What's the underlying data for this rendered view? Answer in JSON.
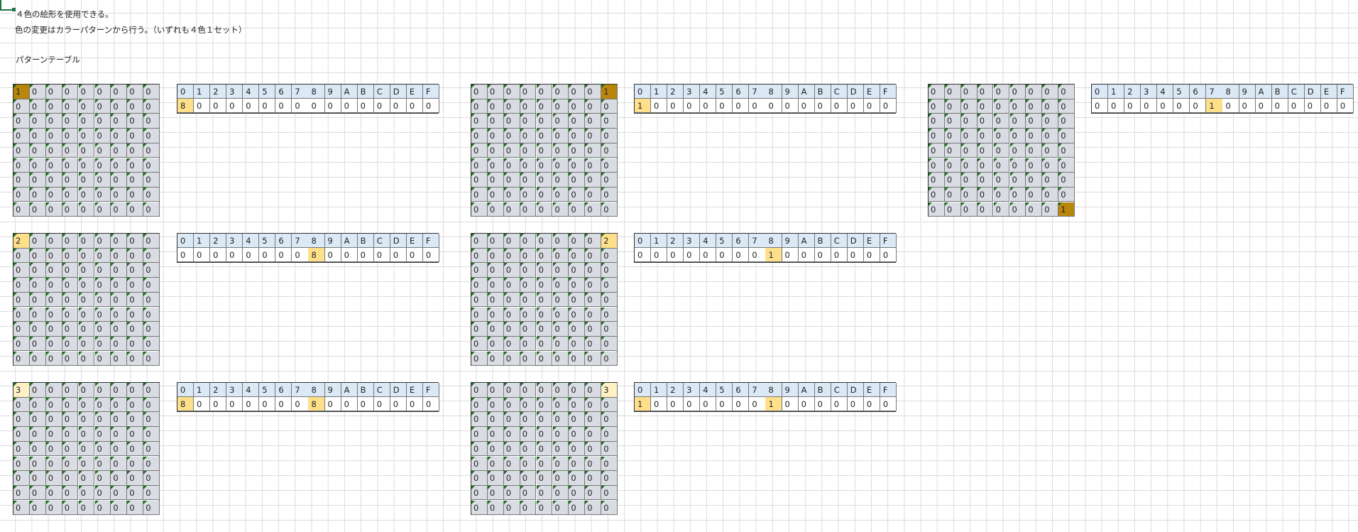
{
  "notes": {
    "line1": "４色の絵形を使用できる。",
    "line2": "色の変更はカラーパターンから行う。（いずれも４色１セット）",
    "line3": "パターンテーブル"
  },
  "colors": {
    "grid_fill": "#d9dde3",
    "dark_highlight": "#b8860b",
    "light_highlight": "#ffe08a",
    "pale_highlight": "#fff1c4",
    "header_fill": "#dbe8f5",
    "corner_mark": "#1b6b1b"
  },
  "pattern_headers": [
    "0",
    "1",
    "2",
    "3",
    "4",
    "5",
    "6",
    "7",
    "8",
    "9",
    "A",
    "B",
    "C",
    "D",
    "E",
    "F"
  ],
  "blocks": [
    {
      "grid": [
        [
          "1",
          "0",
          "0",
          "0",
          "0",
          "0",
          "0",
          "0",
          "0"
        ],
        [
          "0",
          "0",
          "0",
          "0",
          "0",
          "0",
          "0",
          "0",
          "0"
        ],
        [
          "0",
          "0",
          "0",
          "0",
          "0",
          "0",
          "0",
          "0",
          "0"
        ],
        [
          "0",
          "0",
          "0",
          "0",
          "0",
          "0",
          "0",
          "0",
          "0"
        ],
        [
          "0",
          "0",
          "0",
          "0",
          "0",
          "0",
          "0",
          "0",
          "0"
        ],
        [
          "0",
          "0",
          "0",
          "0",
          "0",
          "0",
          "0",
          "0",
          "0"
        ],
        [
          "0",
          "0",
          "0",
          "0",
          "0",
          "0",
          "0",
          "0",
          "0"
        ],
        [
          "0",
          "0",
          "0",
          "0",
          "0",
          "0",
          "0",
          "0",
          "0"
        ],
        [
          "0",
          "0",
          "0",
          "0",
          "0",
          "0",
          "0",
          "0",
          "0"
        ]
      ],
      "highlights": [
        {
          "r": 0,
          "c": 0,
          "style": "hl-dark"
        }
      ],
      "pattern": [
        "8",
        "0",
        "0",
        "0",
        "0",
        "0",
        "0",
        "0",
        "0",
        "0",
        "0",
        "0",
        "0",
        "0",
        "0",
        "0"
      ],
      "pattern_highlights": [
        0
      ]
    },
    {
      "grid": [
        [
          "0",
          "0",
          "0",
          "0",
          "0",
          "0",
          "0",
          "0",
          "1"
        ],
        [
          "0",
          "0",
          "0",
          "0",
          "0",
          "0",
          "0",
          "0",
          "0"
        ],
        [
          "0",
          "0",
          "0",
          "0",
          "0",
          "0",
          "0",
          "0",
          "0"
        ],
        [
          "0",
          "0",
          "0",
          "0",
          "0",
          "0",
          "0",
          "0",
          "0"
        ],
        [
          "0",
          "0",
          "0",
          "0",
          "0",
          "0",
          "0",
          "0",
          "0"
        ],
        [
          "0",
          "0",
          "0",
          "0",
          "0",
          "0",
          "0",
          "0",
          "0"
        ],
        [
          "0",
          "0",
          "0",
          "0",
          "0",
          "0",
          "0",
          "0",
          "0"
        ],
        [
          "0",
          "0",
          "0",
          "0",
          "0",
          "0",
          "0",
          "0",
          "0"
        ],
        [
          "0",
          "0",
          "0",
          "0",
          "0",
          "0",
          "0",
          "0",
          "0"
        ]
      ],
      "highlights": [
        {
          "r": 0,
          "c": 8,
          "style": "hl-dark"
        }
      ],
      "pattern": [
        "1",
        "0",
        "0",
        "0",
        "0",
        "0",
        "0",
        "0",
        "0",
        "0",
        "0",
        "0",
        "0",
        "0",
        "0",
        "0"
      ],
      "pattern_highlights": [
        0
      ]
    },
    {
      "grid": [
        [
          "0",
          "0",
          "0",
          "0",
          "0",
          "0",
          "0",
          "0",
          "0"
        ],
        [
          "0",
          "0",
          "0",
          "0",
          "0",
          "0",
          "0",
          "0",
          "0"
        ],
        [
          "0",
          "0",
          "0",
          "0",
          "0",
          "0",
          "0",
          "0",
          "0"
        ],
        [
          "0",
          "0",
          "0",
          "0",
          "0",
          "0",
          "0",
          "0",
          "0"
        ],
        [
          "0",
          "0",
          "0",
          "0",
          "0",
          "0",
          "0",
          "0",
          "0"
        ],
        [
          "0",
          "0",
          "0",
          "0",
          "0",
          "0",
          "0",
          "0",
          "0"
        ],
        [
          "0",
          "0",
          "0",
          "0",
          "0",
          "0",
          "0",
          "0",
          "0"
        ],
        [
          "0",
          "0",
          "0",
          "0",
          "0",
          "0",
          "0",
          "0",
          "0"
        ],
        [
          "0",
          "0",
          "0",
          "0",
          "0",
          "0",
          "0",
          "0",
          "1"
        ]
      ],
      "highlights": [
        {
          "r": 8,
          "c": 8,
          "style": "hl-dark"
        }
      ],
      "pattern": [
        "0",
        "0",
        "0",
        "0",
        "0",
        "0",
        "0",
        "1",
        "0",
        "0",
        "0",
        "0",
        "0",
        "0",
        "0",
        "0"
      ],
      "pattern_highlights": [
        7
      ]
    },
    {
      "grid": [
        [
          "2",
          "0",
          "0",
          "0",
          "0",
          "0",
          "0",
          "0",
          "0"
        ],
        [
          "0",
          "0",
          "0",
          "0",
          "0",
          "0",
          "0",
          "0",
          "0"
        ],
        [
          "0",
          "0",
          "0",
          "0",
          "0",
          "0",
          "0",
          "0",
          "0"
        ],
        [
          "0",
          "0",
          "0",
          "0",
          "0",
          "0",
          "0",
          "0",
          "0"
        ],
        [
          "0",
          "0",
          "0",
          "0",
          "0",
          "0",
          "0",
          "0",
          "0"
        ],
        [
          "0",
          "0",
          "0",
          "0",
          "0",
          "0",
          "0",
          "0",
          "0"
        ],
        [
          "0",
          "0",
          "0",
          "0",
          "0",
          "0",
          "0",
          "0",
          "0"
        ],
        [
          "0",
          "0",
          "0",
          "0",
          "0",
          "0",
          "0",
          "0",
          "0"
        ],
        [
          "0",
          "0",
          "0",
          "0",
          "0",
          "0",
          "0",
          "0",
          "0"
        ]
      ],
      "highlights": [
        {
          "r": 0,
          "c": 0,
          "style": "hl-light"
        }
      ],
      "pattern": [
        "0",
        "0",
        "0",
        "0",
        "0",
        "0",
        "0",
        "0",
        "8",
        "0",
        "0",
        "0",
        "0",
        "0",
        "0",
        "0"
      ],
      "pattern_highlights": [
        8
      ]
    },
    {
      "grid": [
        [
          "0",
          "0",
          "0",
          "0",
          "0",
          "0",
          "0",
          "0",
          "2"
        ],
        [
          "0",
          "0",
          "0",
          "0",
          "0",
          "0",
          "0",
          "0",
          "0"
        ],
        [
          "0",
          "0",
          "0",
          "0",
          "0",
          "0",
          "0",
          "0",
          "0"
        ],
        [
          "0",
          "0",
          "0",
          "0",
          "0",
          "0",
          "0",
          "0",
          "0"
        ],
        [
          "0",
          "0",
          "0",
          "0",
          "0",
          "0",
          "0",
          "0",
          "0"
        ],
        [
          "0",
          "0",
          "0",
          "0",
          "0",
          "0",
          "0",
          "0",
          "0"
        ],
        [
          "0",
          "0",
          "0",
          "0",
          "0",
          "0",
          "0",
          "0",
          "0"
        ],
        [
          "0",
          "0",
          "0",
          "0",
          "0",
          "0",
          "0",
          "0",
          "0"
        ],
        [
          "0",
          "0",
          "0",
          "0",
          "0",
          "0",
          "0",
          "0",
          "0"
        ]
      ],
      "highlights": [
        {
          "r": 0,
          "c": 8,
          "style": "hl-light"
        }
      ],
      "pattern": [
        "0",
        "0",
        "0",
        "0",
        "0",
        "0",
        "0",
        "0",
        "1",
        "0",
        "0",
        "0",
        "0",
        "0",
        "0",
        "0"
      ],
      "pattern_highlights": [
        8
      ]
    },
    {
      "grid": [
        [
          "3",
          "0",
          "0",
          "0",
          "0",
          "0",
          "0",
          "0",
          "0"
        ],
        [
          "0",
          "0",
          "0",
          "0",
          "0",
          "0",
          "0",
          "0",
          "0"
        ],
        [
          "0",
          "0",
          "0",
          "0",
          "0",
          "0",
          "0",
          "0",
          "0"
        ],
        [
          "0",
          "0",
          "0",
          "0",
          "0",
          "0",
          "0",
          "0",
          "0"
        ],
        [
          "0",
          "0",
          "0",
          "0",
          "0",
          "0",
          "0",
          "0",
          "0"
        ],
        [
          "0",
          "0",
          "0",
          "0",
          "0",
          "0",
          "0",
          "0",
          "0"
        ],
        [
          "0",
          "0",
          "0",
          "0",
          "0",
          "0",
          "0",
          "0",
          "0"
        ],
        [
          "0",
          "0",
          "0",
          "0",
          "0",
          "0",
          "0",
          "0",
          "0"
        ],
        [
          "0",
          "0",
          "0",
          "0",
          "0",
          "0",
          "0",
          "0",
          "0"
        ]
      ],
      "highlights": [
        {
          "r": 0,
          "c": 0,
          "style": "hl-pale"
        }
      ],
      "pattern": [
        "8",
        "0",
        "0",
        "0",
        "0",
        "0",
        "0",
        "0",
        "8",
        "0",
        "0",
        "0",
        "0",
        "0",
        "0",
        "0"
      ],
      "pattern_highlights": [
        0,
        8
      ]
    },
    {
      "grid": [
        [
          "0",
          "0",
          "0",
          "0",
          "0",
          "0",
          "0",
          "0",
          "3"
        ],
        [
          "0",
          "0",
          "0",
          "0",
          "0",
          "0",
          "0",
          "0",
          "0"
        ],
        [
          "0",
          "0",
          "0",
          "0",
          "0",
          "0",
          "0",
          "0",
          "0"
        ],
        [
          "0",
          "0",
          "0",
          "0",
          "0",
          "0",
          "0",
          "0",
          "0"
        ],
        [
          "0",
          "0",
          "0",
          "0",
          "0",
          "0",
          "0",
          "0",
          "0"
        ],
        [
          "0",
          "0",
          "0",
          "0",
          "0",
          "0",
          "0",
          "0",
          "0"
        ],
        [
          "0",
          "0",
          "0",
          "0",
          "0",
          "0",
          "0",
          "0",
          "0"
        ],
        [
          "0",
          "0",
          "0",
          "0",
          "0",
          "0",
          "0",
          "0",
          "0"
        ],
        [
          "0",
          "0",
          "0",
          "0",
          "0",
          "0",
          "0",
          "0",
          "0"
        ]
      ],
      "highlights": [
        {
          "r": 0,
          "c": 8,
          "style": "hl-pale"
        }
      ],
      "pattern": [
        "1",
        "0",
        "0",
        "0",
        "0",
        "0",
        "0",
        "0",
        "1",
        "0",
        "0",
        "0",
        "0",
        "0",
        "0",
        "0"
      ],
      "pattern_highlights": [
        0,
        8
      ]
    }
  ]
}
